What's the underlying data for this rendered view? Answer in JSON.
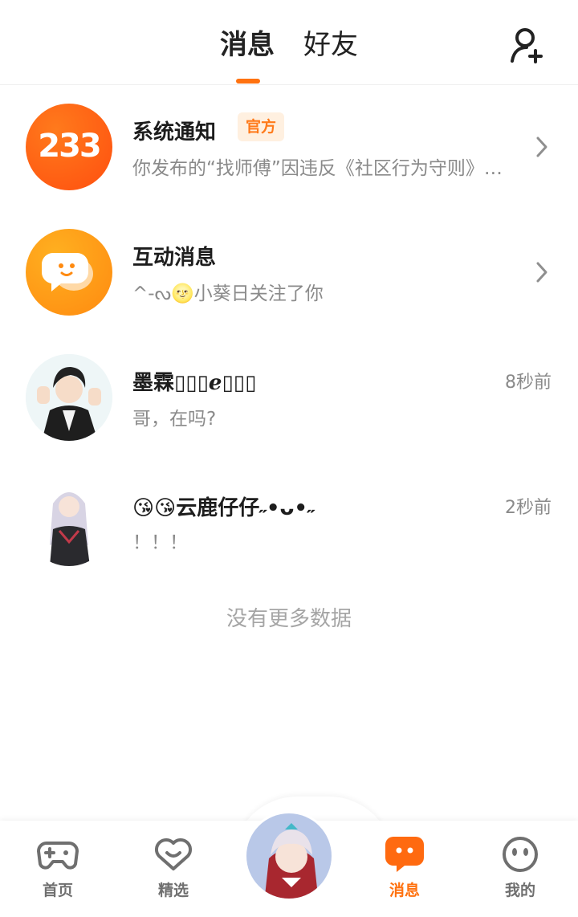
{
  "header": {
    "tabs": [
      {
        "label": "消息",
        "active": true
      },
      {
        "label": "好友",
        "active": false
      }
    ],
    "add_friend_icon": "add-user-icon",
    "accent_color": "#ff7210"
  },
  "messages": [
    {
      "title": "系统通知",
      "badge": "官方",
      "avatar_text": "233",
      "preview": "你发布的“找师傅”因违反《社区行为守则》…",
      "has_chevron": true
    },
    {
      "title": "互动消息",
      "preview": "^-ᔓ🌝小葵日关注了你",
      "has_chevron": true
    },
    {
      "title": "墨霖▯▯▯ℯ▯▯▯",
      "preview": "哥，在吗?",
      "time": "8秒前"
    },
    {
      "title": "😘😘云鹿仔仔˶•ᴗ•˶",
      "preview": "！！！",
      "time": "2秒前"
    }
  ],
  "footer_text": "没有更多数据",
  "nav": [
    {
      "label": "首页",
      "icon": "gamepad-icon",
      "active": false
    },
    {
      "label": "精选",
      "icon": "heart-chat-icon",
      "active": false
    },
    {
      "label": "消息",
      "icon": "message-icon",
      "active": true
    },
    {
      "label": "我的",
      "icon": "face-icon",
      "active": false
    }
  ]
}
